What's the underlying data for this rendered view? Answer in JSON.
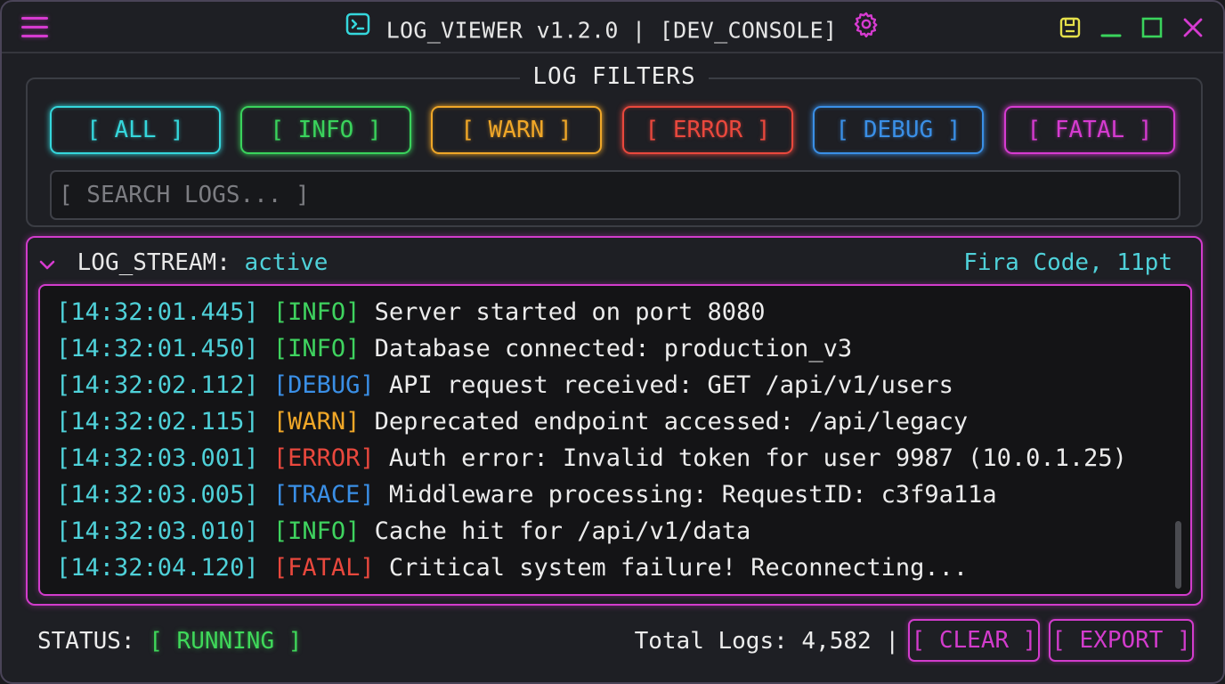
{
  "window": {
    "title": "LOG_VIEWER v1.2.0 | [DEV_CONSOLE]",
    "icons": {
      "menu": "hamburger-menu-icon",
      "app": "terminal-icon",
      "settings": "gear-icon",
      "save": "save-icon",
      "minimize": "minimize-icon",
      "maximize": "maximize-icon",
      "close": "close-icon"
    }
  },
  "filters": {
    "legend": "LOG FILTERS",
    "buttons": [
      {
        "label": "[ ALL ]",
        "color": "#35d7dc"
      },
      {
        "label": "[ INFO ]",
        "color": "#3ad35c"
      },
      {
        "label": "[ WARN ]",
        "color": "#f0a728"
      },
      {
        "label": "[ ERROR ]",
        "color": "#e9483d"
      },
      {
        "label": "[ DEBUG ]",
        "color": "#3a8fe6"
      },
      {
        "label": "[ FATAL ]",
        "color": "#d63bd0"
      }
    ],
    "search_placeholder": "[ SEARCH LOGS... ]"
  },
  "stream": {
    "label": "LOG_STREAM:",
    "state": "active",
    "font_info": "Fira Code, 11pt",
    "level_colors": {
      "INFO": "#3fd35f",
      "DEBUG": "#3a8fe6",
      "WARN": "#f0a728",
      "ERROR": "#e9483d",
      "TRACE": "#3a8fe6",
      "FATAL": "#e9483d"
    },
    "lines": [
      {
        "ts": "[14:32:01.445]",
        "level": "INFO",
        "tag": "[INFO]",
        "msg": "Server started on port 8080"
      },
      {
        "ts": "[14:32:01.450]",
        "level": "INFO",
        "tag": "[INFO]",
        "msg": "Database connected: production_v3"
      },
      {
        "ts": "[14:32:02.112]",
        "level": "DEBUG",
        "tag": "[DEBUG]",
        "msg": "API request received: GET /api/v1/users"
      },
      {
        "ts": "[14:32:02.115]",
        "level": "WARN",
        "tag": "[WARN]",
        "msg": "Deprecated endpoint accessed: /api/legacy"
      },
      {
        "ts": "[14:32:03.001]",
        "level": "ERROR",
        "tag": "[ERROR]",
        "msg": "Auth error: Invalid token for user 9987 (10.0.1.25)"
      },
      {
        "ts": "[14:32:03.005]",
        "level": "TRACE",
        "tag": "[TRACE]",
        "msg": "Middleware processing: RequestID: c3f9a11a"
      },
      {
        "ts": "[14:32:03.010]",
        "level": "INFO",
        "tag": "[INFO]",
        "msg": "Cache hit for /api/v1/data"
      },
      {
        "ts": "[14:32:04.120]",
        "level": "FATAL",
        "tag": "[FATAL]",
        "msg": "Critical system failure! Reconnecting..."
      }
    ]
  },
  "statusbar": {
    "status_label": "STATUS:",
    "status_value": "[ RUNNING ]",
    "total_logs": "Total Logs: 4,582 |",
    "clear_label": "[ CLEAR ]",
    "export_label": "[ EXPORT ]"
  }
}
